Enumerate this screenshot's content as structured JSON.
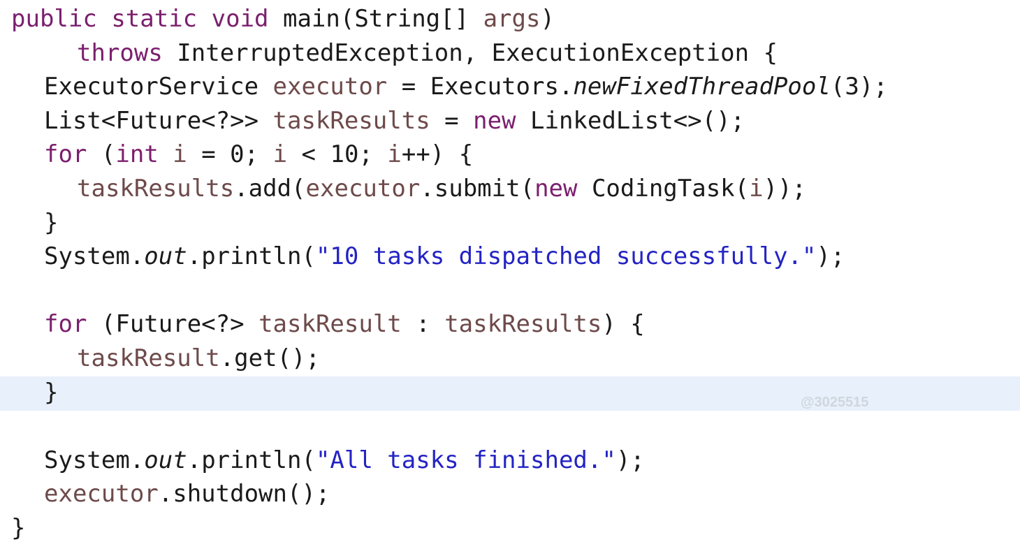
{
  "lines": {
    "l1": {
      "kw_public": "public",
      "kw_static": "static",
      "kw_void": "void",
      "text_main": " main(String[] ",
      "param_args": "args",
      "close": ")"
    },
    "l2": {
      "kw_throws": "throws",
      "text": " InterruptedException, ExecutionException {"
    },
    "l3": {
      "type": "ExecutorService ",
      "var_executor": "executor",
      "text_eq": " = Executors.",
      "method_italic": "newFixedThreadPool",
      "args": "(3);"
    },
    "l4": {
      "type": "List<Future<?>> ",
      "var_taskResults": "taskResults",
      "text_eq": " = ",
      "kw_new": "new",
      "text_rest": " LinkedList<>();"
    },
    "l5": {
      "kw_for": "for",
      "text_open": " (",
      "kw_int": "int",
      "text_sp": " ",
      "var_i1": "i",
      "text_init": " = 0; ",
      "var_i2": "i",
      "text_cond": " < 10; ",
      "var_i3": "i",
      "text_inc": "++) {"
    },
    "l6": {
      "var_taskResults": "taskResults",
      "text_add": ".add(",
      "var_executor": "executor",
      "text_submit": ".submit(",
      "kw_new": "new",
      "text_task": " CodingTask(",
      "var_i": "i",
      "text_close": "));"
    },
    "l7": {
      "text": "}"
    },
    "l8": {
      "text_system": "System.",
      "field_out": "out",
      "text_println": ".println(",
      "string": "\"10 tasks dispatched successfully.\"",
      "text_close": ");"
    },
    "l10": {
      "kw_for": "for",
      "text_open": " (Future<?> ",
      "var_taskResult": "taskResult",
      "text_colon": " : ",
      "var_taskResults": "taskResults",
      "text_close": ") {"
    },
    "l11": {
      "var_taskResult": "taskResult",
      "text_get": ".get();"
    },
    "l12": {
      "text": "}"
    },
    "l14": {
      "text_system": "System.",
      "field_out": "out",
      "text_println": ".println(",
      "string": "\"All tasks finished.\"",
      "text_close": ");"
    },
    "l15": {
      "var_executor": "executor",
      "text_shutdown": ".shutdown();"
    },
    "l16": {
      "text": "}"
    }
  },
  "watermark": "@3025515",
  "colors": {
    "keyword": "#7b1f6e",
    "variable": "#6e4a4a",
    "string": "#2323c4",
    "current_line": "#e8f0fb"
  }
}
